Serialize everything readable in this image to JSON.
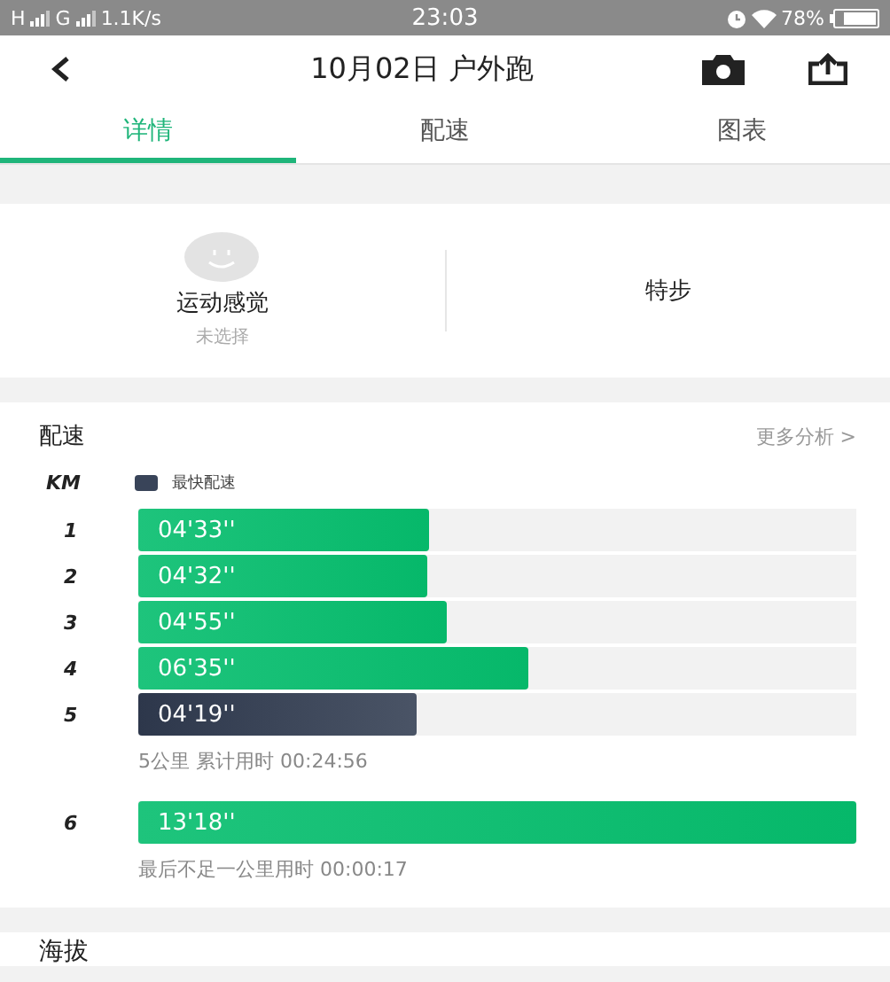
{
  "status_bar": {
    "network_1": "H",
    "network_2": "G",
    "speed": "1.1K/s",
    "time": "23:03",
    "battery": "78%"
  },
  "header": {
    "title": "10月02日 户外跑"
  },
  "tabs": [
    {
      "label": "详情",
      "selected": true
    },
    {
      "label": "配速",
      "selected": false
    },
    {
      "label": "图表",
      "selected": false
    }
  ],
  "feel": {
    "label": "运动感觉",
    "value": "未选择"
  },
  "shoe": {
    "label": "特步"
  },
  "pace": {
    "title": "配速",
    "more": "更多分析 >",
    "unit": "KM",
    "legend": "最快配速",
    "groups": [
      {
        "splits": [
          {
            "km": "1",
            "time": "04'33''",
            "level": 0.405,
            "fastest": false
          },
          {
            "km": "2",
            "time": "04'32''",
            "level": 0.403,
            "fastest": false
          },
          {
            "km": "3",
            "time": "04'55''",
            "level": 0.43,
            "fastest": false
          },
          {
            "km": "4",
            "time": "06'35''",
            "level": 0.543,
            "fastest": false
          },
          {
            "km": "5",
            "time": "04'19''",
            "level": 0.388,
            "fastest": true
          }
        ],
        "note": "5公里 累计用时 00:24:56"
      },
      {
        "splits": [
          {
            "km": "6",
            "time": "13'18''",
            "level": 1,
            "fastest": false
          }
        ],
        "note": "最后不足一公里用时 00:00:17"
      }
    ]
  },
  "next_section": {
    "title": "海拔"
  }
}
